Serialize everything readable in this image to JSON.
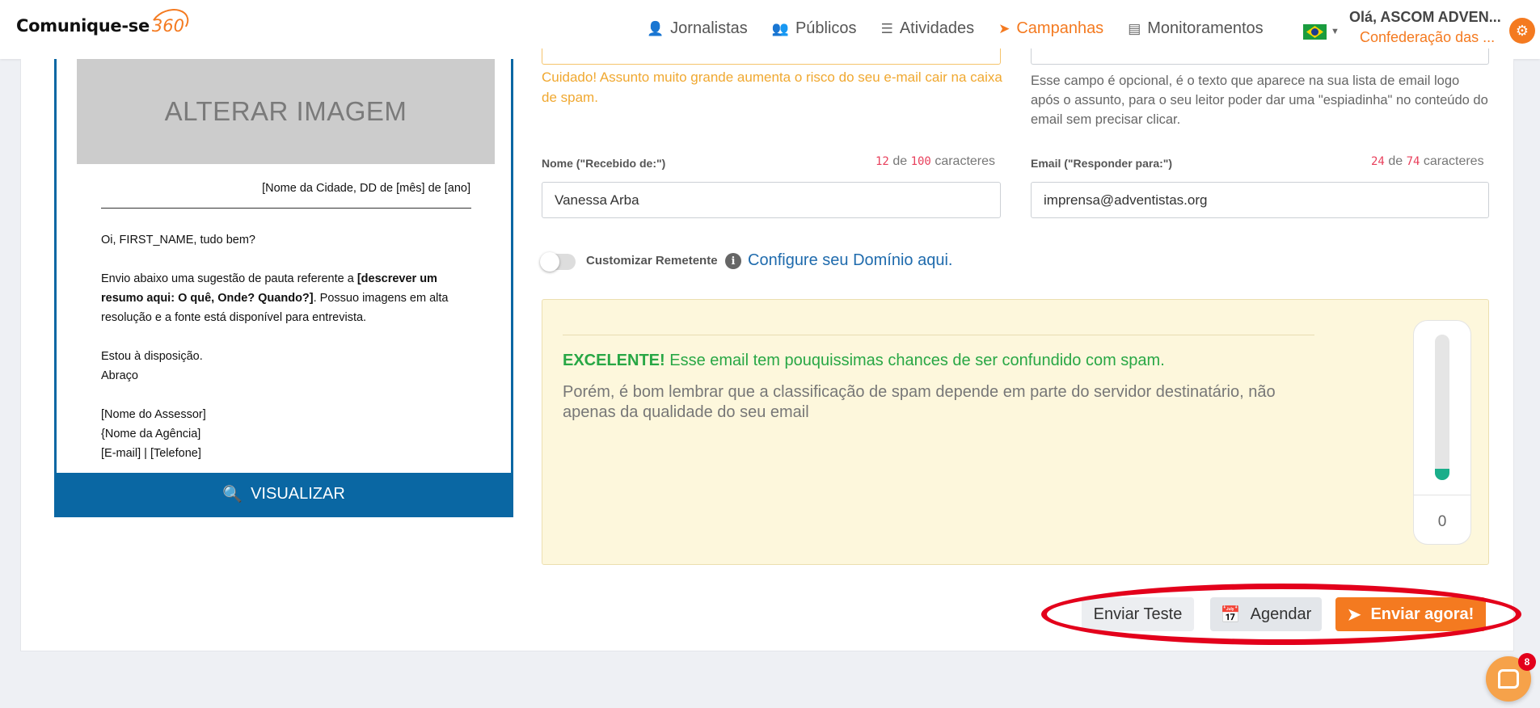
{
  "brand": {
    "name": "Comunique-se",
    "suffix": "360",
    "accent": "#f47a20"
  },
  "nav": [
    {
      "label": "Jornalistas",
      "icon": "person-icon"
    },
    {
      "label": "Públicos",
      "icon": "users-icon"
    },
    {
      "label": "Atividades",
      "icon": "checklist-icon"
    },
    {
      "label": "Campanhas",
      "icon": "paper-plane-icon",
      "active": true
    },
    {
      "label": "Monitoramentos",
      "icon": "newspaper-icon"
    }
  ],
  "user": {
    "greeting": "Olá, ASCOM ADVEN...",
    "org": "Confederação das ..."
  },
  "preview": {
    "image_placeholder": "ALTERAR IMAGEM",
    "date_line": "[Nome da Cidade, DD de [mês] de [ano]",
    "greeting": "Oi, FIRST_NAME, tudo bem?",
    "body_prefix": "Envio abaixo uma sugestão de pauta referente a ",
    "body_bold": "[descrever um resumo aqui: O quê, Onde? Quando?]",
    "body_suffix": ". Possuo imagens em alta resolução e a fonte está disponível para entrevista.",
    "closing_1": "Estou à disposição.",
    "closing_2": "Abraço",
    "sig_1": "[Nome do Assessor]",
    "sig_2": "{Nome da Agência]",
    "sig_3": "[E-mail] | [Telefone]",
    "view_button": "VISUALIZAR"
  },
  "subject": {
    "warning": "Cuidado! Assunto muito grande aumenta o risco do seu e-mail cair na caixa de spam."
  },
  "preheader": {
    "help": "Esse campo é opcional, é o texto que aparece na sua lista de email logo após o assunto, para o seu leitor poder dar uma \"espiadinha\" no conteúdo do email sem precisar clicar."
  },
  "sender_name": {
    "label": "Nome (\"Recebido de:\")",
    "count": "12",
    "max": "100",
    "of": "de",
    "unit": "caracteres",
    "value": "Vanessa Arba"
  },
  "reply_to": {
    "label": "Email (\"Responder para:\")",
    "count": "24",
    "max": "74",
    "of": "de",
    "unit": "caracteres",
    "value": "imprensa@adventistas.org"
  },
  "custom_sender": {
    "label": "Customizar Remetente",
    "enabled": false,
    "link": "Configure seu Domínio aqui."
  },
  "spam_check": {
    "headline_bold": "EXCELENTE!",
    "headline_rest": " Esse email tem pouquissimas chances de ser confundido com spam.",
    "note": "Porém, é bom lembrar que a classificação de spam depende em parte do servidor destinatário, não apenas da qualidade do seu email",
    "score": "0",
    "meter_level": 0.08
  },
  "actions": {
    "test": "Enviar Teste",
    "schedule": "Agendar",
    "send": "Enviar agora!"
  },
  "chat": {
    "badge": "8"
  }
}
